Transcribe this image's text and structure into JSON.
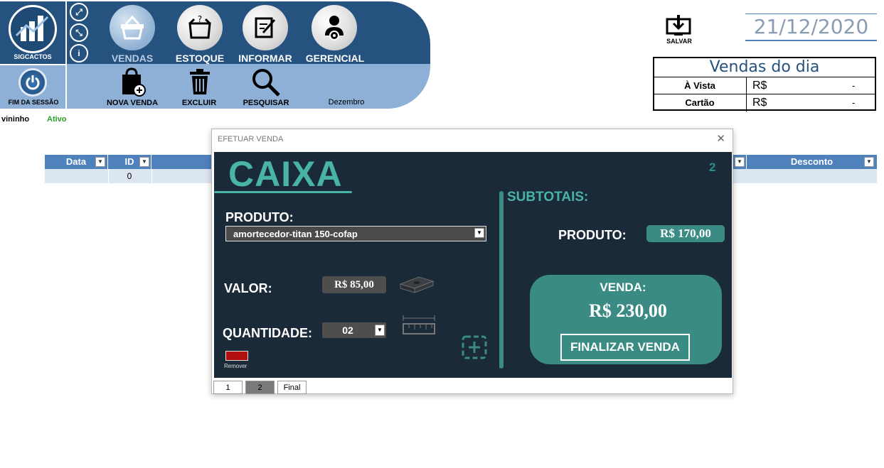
{
  "ribbon": {
    "logo_label": "SIGCACTOS",
    "logout_label": "FIM DA SESSÃO",
    "nav": [
      {
        "label": "VENDAS"
      },
      {
        "label": "ESTOQUE"
      },
      {
        "label": "INFORMAR"
      },
      {
        "label": "GERENCIAL"
      }
    ],
    "actions": [
      {
        "label": "NOVA VENDA"
      },
      {
        "label": "EXCLUIR"
      },
      {
        "label": "PESQUISAR"
      }
    ],
    "month": "Dezembro"
  },
  "user": {
    "name": "vininho",
    "status": "Ativo"
  },
  "save": {
    "label": "SALVAR"
  },
  "date": "21/12/2020",
  "summary": {
    "title": "Vendas do dia",
    "rows": [
      {
        "label": "À Vista",
        "currency": "R$",
        "value": "-"
      },
      {
        "label": "Cartão",
        "currency": "R$",
        "value": "-"
      }
    ]
  },
  "table": {
    "headers": [
      "Data",
      "ID",
      "Desconto"
    ],
    "row": {
      "id": "0"
    }
  },
  "modal": {
    "title": "EFETUAR VENDA",
    "close": "✕",
    "caixa": "CAIXA",
    "counter": "2",
    "produto_label": "PRODUTO:",
    "produto_value": "amortecedor-titan 150-cofap",
    "valor_label": "VALOR:",
    "valor_value": "R$ 85,00",
    "quantidade_label": "QUANTIDADE:",
    "quantidade_value": "02",
    "remover_label": "Remover",
    "subtotais_label": "SUBTOTAIS:",
    "sub_produto_label": "PRODUTO:",
    "sub_produto_value": "R$ 170,00",
    "venda_label": "VENDA:",
    "venda_value": "R$ 230,00",
    "finalizar_label": "FINALIZAR VENDA",
    "tabs": [
      "1",
      "2",
      "Final"
    ]
  },
  "colors": {
    "ribbon_dark": "#25527f",
    "ribbon_light": "#8eb0d7",
    "teal": "#3a8b83",
    "panel": "#1b2a38"
  }
}
